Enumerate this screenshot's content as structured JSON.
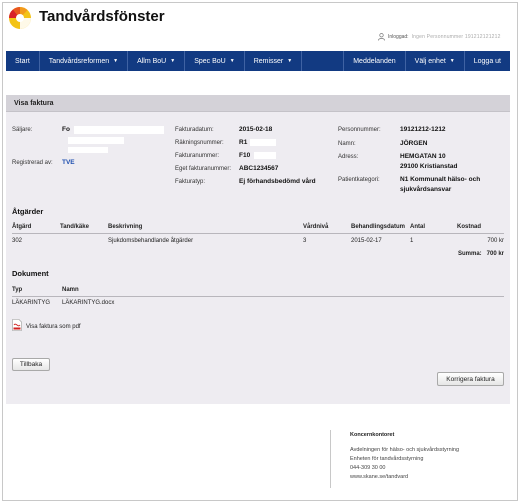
{
  "app": {
    "title": "Tandvårdsfönster"
  },
  "user": {
    "label": "Inloggad:",
    "name": "Ingen Personnummer 191212121212"
  },
  "nav": {
    "left": [
      {
        "label": "Start",
        "dropdown": false
      },
      {
        "label": "Tandvårdsreformen",
        "dropdown": true
      },
      {
        "label": "Allm BoU",
        "dropdown": true
      },
      {
        "label": "Spec BoU",
        "dropdown": true
      },
      {
        "label": "Remisser",
        "dropdown": true
      }
    ],
    "right": [
      {
        "label": "Meddelanden",
        "dropdown": false
      },
      {
        "label": "Välj enhet",
        "dropdown": true
      },
      {
        "label": "Logga ut",
        "dropdown": false
      }
    ]
  },
  "panel": {
    "title": "Visa faktura"
  },
  "invoice": {
    "seller_label": "Säljare:",
    "seller_lines": [
      "Fo",
      "",
      ""
    ],
    "registered_label": "Registrerad av:",
    "registered_value": "TVE",
    "fields_mid": [
      {
        "label": "Fakturadatum:",
        "value": "2015-02-18"
      },
      {
        "label": "Räkningsnummer:",
        "value": "R1"
      },
      {
        "label": "Fakturanummer:",
        "value": "F10"
      },
      {
        "label": "Eget fakturanummer:",
        "value": "ABC1234567"
      },
      {
        "label": "Fakturatyp:",
        "value": "Ej förhandsbedömd vård"
      }
    ],
    "personnummer_label": "Personnummer:",
    "personnummer_value": "19121212-1212",
    "name_label": "Namn:",
    "name_value": "JÖRGEN",
    "address_label": "Adress:",
    "address_line1": "HEMGATAN 10",
    "address_line2": "29100 Kristianstad",
    "patientkategori_label": "Patientkategori:",
    "patientkategori_line1": "N1 Kommunalt hälso- och",
    "patientkategori_line2": "sjukvårdsansvar"
  },
  "atgarder": {
    "title": "Åtgärder",
    "headers": {
      "code": "Åtgärd",
      "tooth": "Tand/käke",
      "desc": "Beskrivning",
      "level": "Vårdnivå",
      "date": "Behandlingsdatum",
      "qty": "Antal",
      "cost": "Kostnad"
    },
    "rows": [
      {
        "code": "302",
        "tooth": "",
        "desc": "Sjukdomsbehandlande åtgärder",
        "level": "3",
        "date": "2015-02-17",
        "qty": "1",
        "cost": "700 kr"
      }
    ],
    "sum_label": "Summa:",
    "sum_value": "700 kr"
  },
  "dokument": {
    "title": "Dokument",
    "headers": {
      "type": "Typ",
      "name": "Namn"
    },
    "rows": [
      {
        "type": "LÄKARINTYG",
        "name": "LÄKARINTYG.docx"
      }
    ],
    "pdf_link": "Visa faktura som pdf"
  },
  "buttons": {
    "back": "Tillbaka",
    "correct": "Korrigera faktura"
  },
  "footer": {
    "title": "Koncernkontoret",
    "line1": "Avdelningen för hälso- och sjukvårdsstyrning",
    "line2": "Enheten för tandvårdsstyrning",
    "phone": "044-309 30 00",
    "url": "www.skane.se/tandvard"
  },
  "colors": {
    "nav_bg": "#123a82",
    "link": "#1e4fb0",
    "panel_bg": "#eeecf1",
    "panel_head": "#d4d2d8"
  }
}
